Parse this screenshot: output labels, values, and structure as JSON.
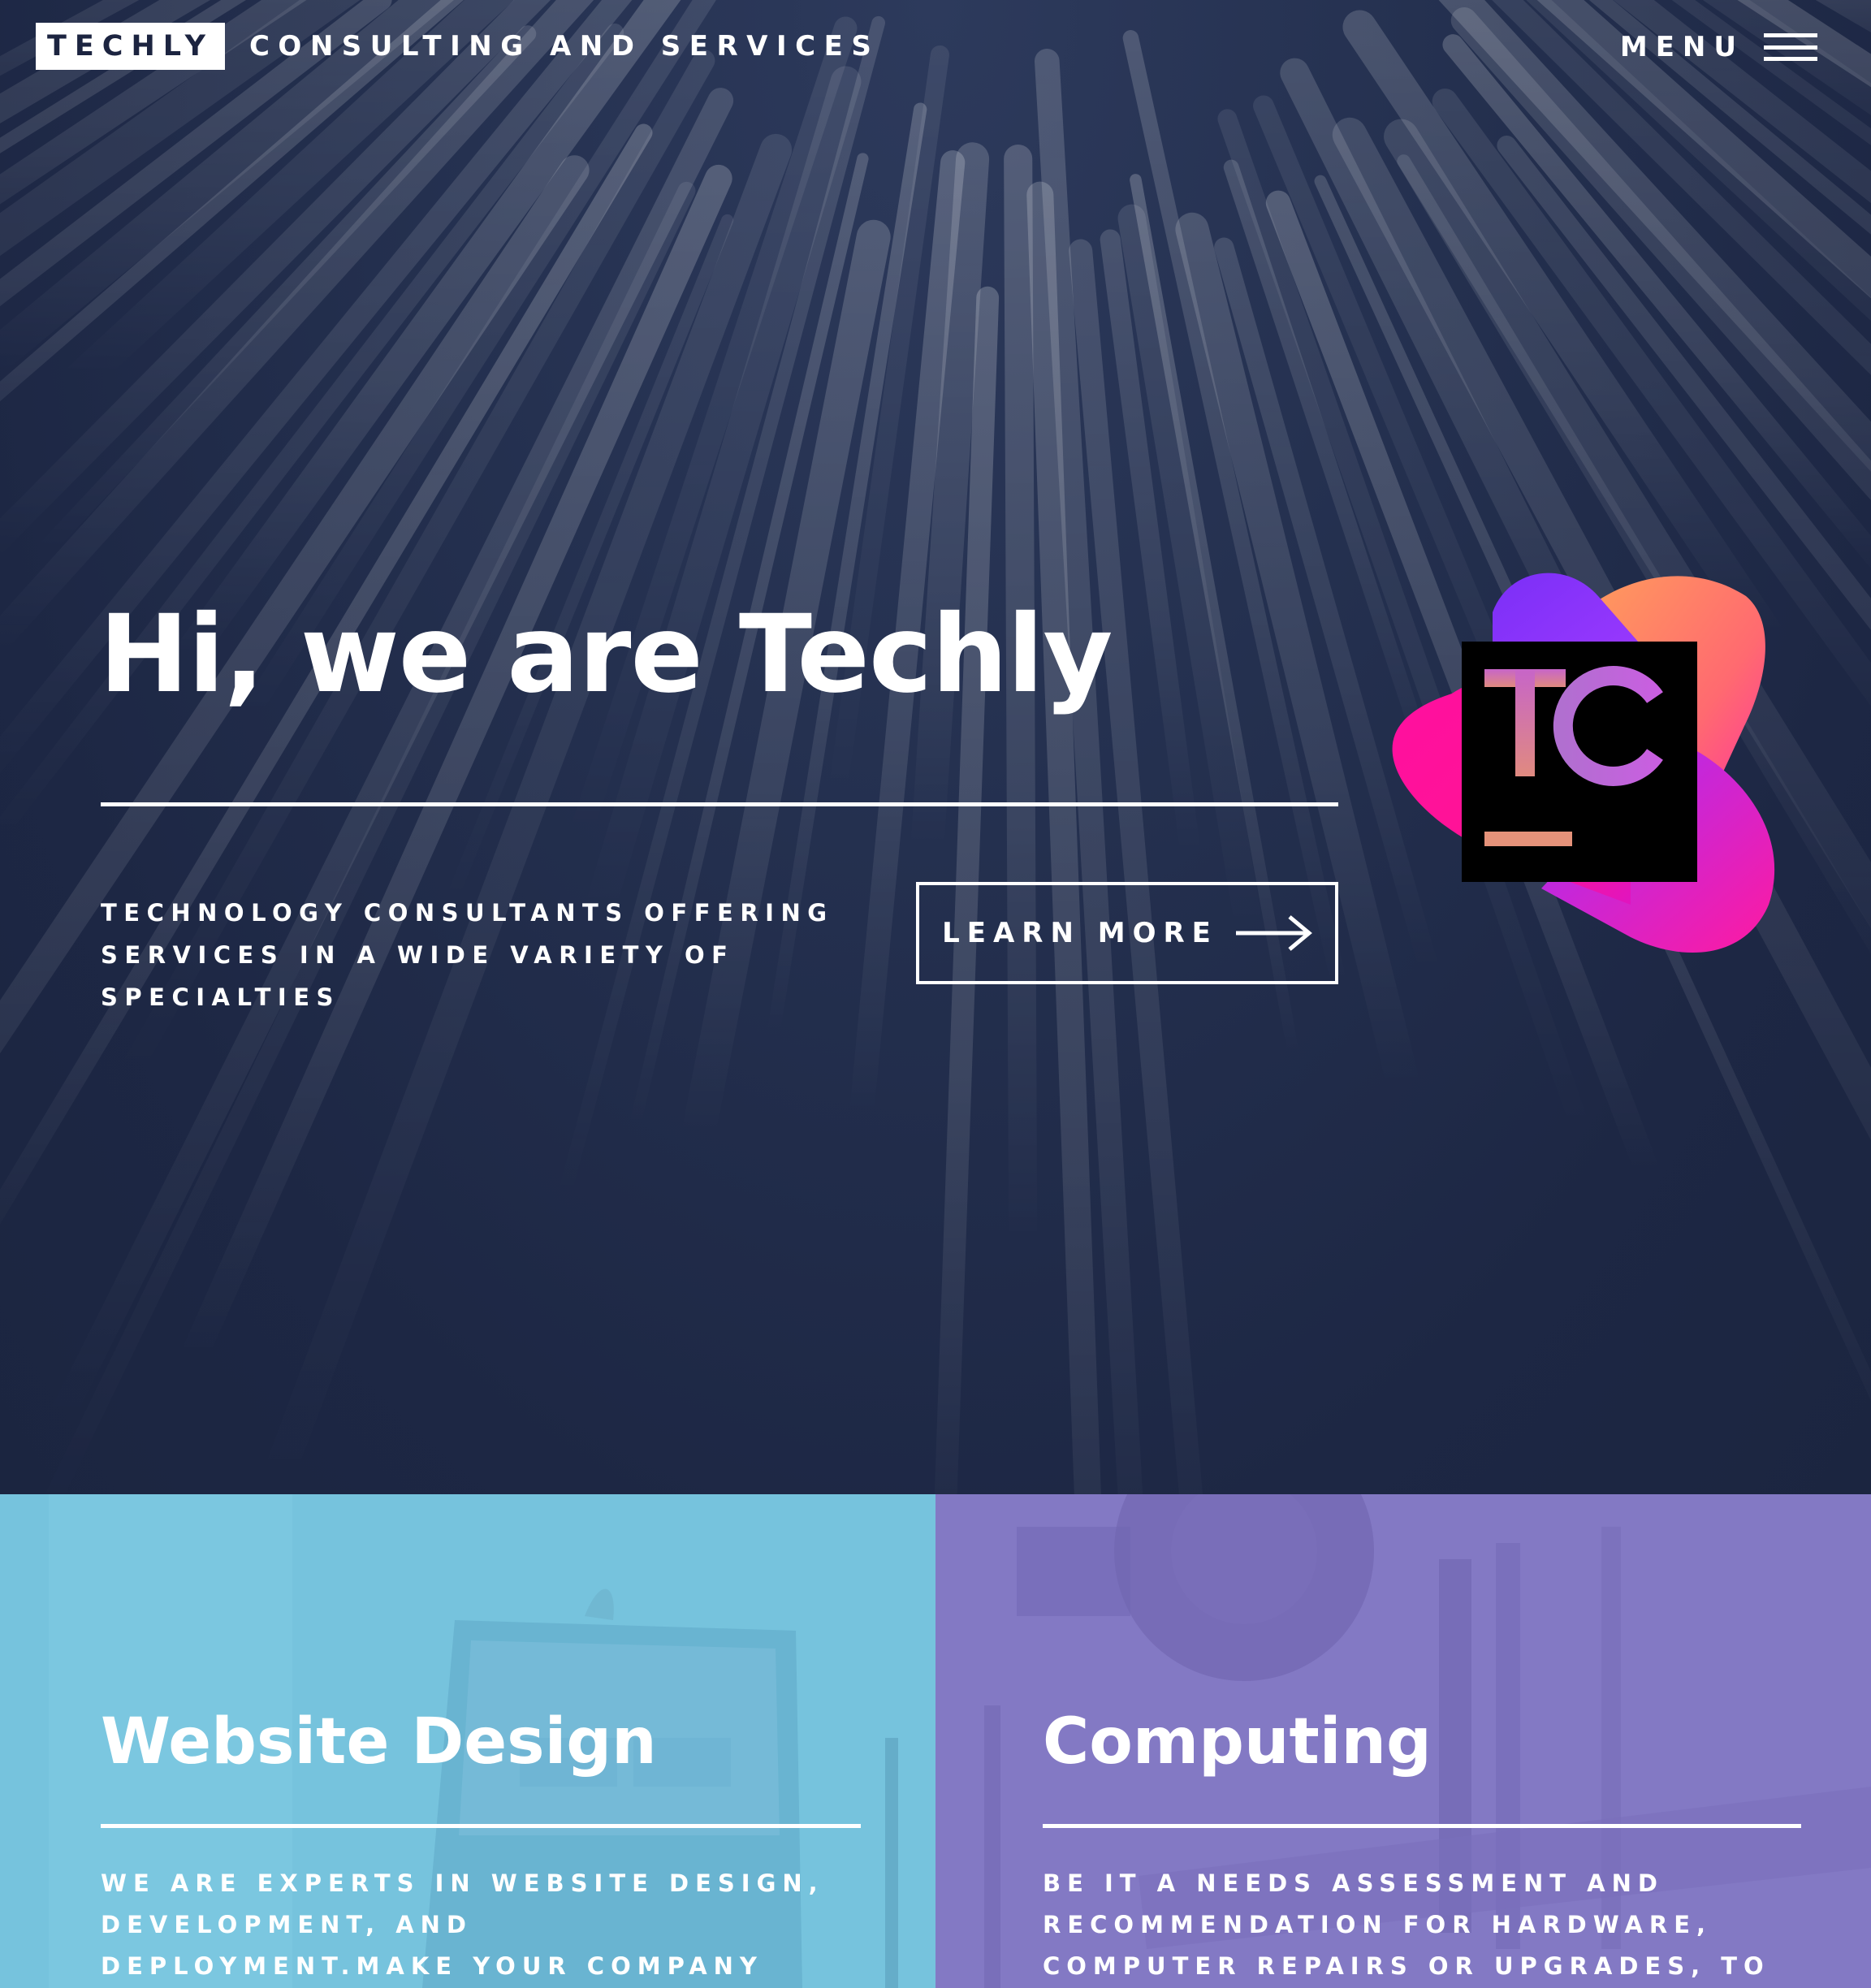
{
  "header": {
    "brand": "TECHLY",
    "tagline": "CONSULTING AND SERVICES",
    "menu_label": "MENU"
  },
  "hero": {
    "title": "Hi, we are Techly",
    "subtitle": "TECHNOLOGY CONSULTANTS OFFERING SERVICES IN A WIDE VARIETY OF SPECIALTIES",
    "cta_label": "LEARN MORE",
    "cta_icon": "arrow-right-icon",
    "logo_letters": "TC",
    "logo_colors": {
      "purple": "#7b2ff7",
      "orange": "#ff9a55",
      "magenta": "#ff1493",
      "box": "#000000"
    }
  },
  "services": [
    {
      "title": "Website Design",
      "description": "WE ARE EXPERTS IN WEBSITE DESIGN, DEVELOPMENT, AND DEPLOYMENT.MAKE YOUR COMPANY STAND OUT WITH A SLEEK",
      "color": "#76c3dd"
    },
    {
      "title": "Computing",
      "description": "BE IT A NEEDS ASSESSMENT AND RECOMMENDATION FOR HARDWARE, COMPUTER REPAIRS OR UPGRADES, TO EVEN",
      "color": "#8379c4"
    }
  ],
  "colors": {
    "hero_bg": "#1f2a47",
    "text": "#ffffff"
  }
}
